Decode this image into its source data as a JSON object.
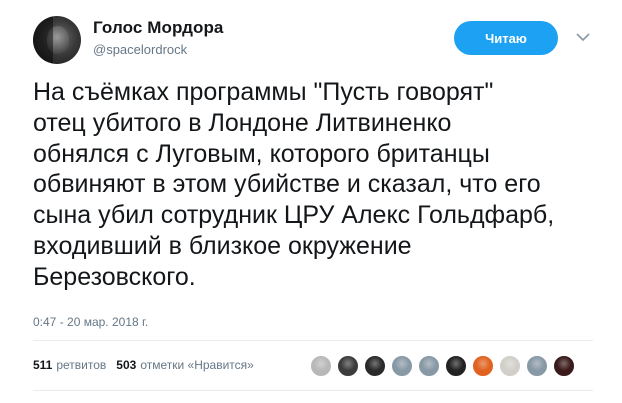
{
  "author": {
    "display_name": "Голос Мордора",
    "handle": "@spacelordrock"
  },
  "follow_button_label": "Читаю",
  "tweet": {
    "lines": [
      "На съёмках программы \"Пусть говорят\"",
      "отец убитого в Лондоне Литвиненко",
      "обнялся с Луговым, которого британцы",
      "обвиняют в этом убийстве и сказал, что его",
      "сына убил сотрудник ЦРУ Алекс Гольдфарб,",
      "входивший в близкое окружение",
      "Березовского."
    ],
    "timestamp": "0:47 - 20 мар. 2018 г."
  },
  "stats": {
    "retweets_count": "511",
    "retweets_label": "ретвитов",
    "likes_count": "503",
    "likes_label": "отметки «Нравится»"
  },
  "likers": [
    {
      "icon": "avatar-dog",
      "color": "#b8b8b8"
    },
    {
      "icon": "avatar-dark",
      "color": "#3c3c3c"
    },
    {
      "icon": "avatar-person",
      "color": "#2a2a2a"
    },
    {
      "icon": "avatar-default",
      "color": "#8899a6"
    },
    {
      "icon": "avatar-default",
      "color": "#8899a6"
    },
    {
      "icon": "avatar-dark",
      "color": "#222222"
    },
    {
      "icon": "avatar-orange",
      "color": "#e0621f"
    },
    {
      "icon": "avatar-light",
      "color": "#d2cfc9"
    },
    {
      "icon": "avatar-default",
      "color": "#8899a6"
    },
    {
      "icon": "avatar-red",
      "color": "#3a1a1a"
    }
  ],
  "colors": {
    "accent": "#1da1f2",
    "text": "#14171a",
    "secondary": "#657786"
  }
}
